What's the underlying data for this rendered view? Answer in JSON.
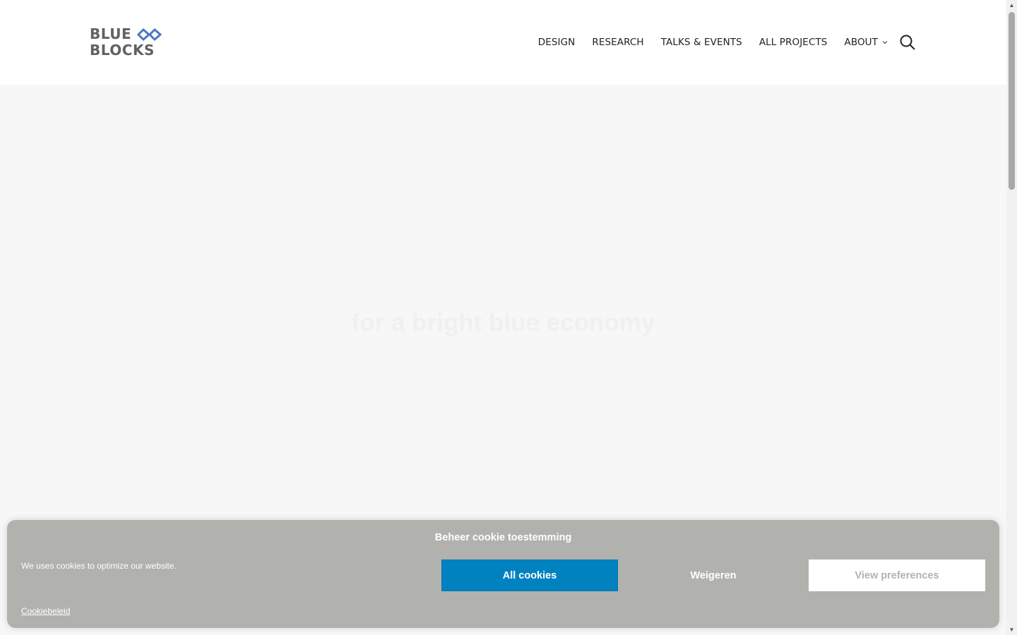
{
  "header": {
    "logo": {
      "line1": "BLUE",
      "line2": "BLOCKS",
      "icon": "infinity-icon",
      "text_color": "#5f6360",
      "icon_color": "#4a78c2"
    },
    "nav": {
      "items": [
        {
          "label": "DESIGN"
        },
        {
          "label": "RESEARCH"
        },
        {
          "label": "TALKS & EVENTS"
        },
        {
          "label": "ALL PROJECTS"
        },
        {
          "label": "ABOUT",
          "has_dropdown": true
        }
      ],
      "search_icon": "search-icon"
    }
  },
  "hero": {
    "tagline": "for a bright blue economy",
    "background": "#f7f7f7"
  },
  "cookie_banner": {
    "title": "Beheer cookie toestemming",
    "message": "We uses cookies to optimize our website.",
    "buttons": {
      "accept": "All cookies",
      "deny": "Weigeren",
      "preferences": "View preferences"
    },
    "policy_link": "Cookiebeleid",
    "colors": {
      "background": "#b1b2ae",
      "accept": "#0082c0"
    }
  }
}
